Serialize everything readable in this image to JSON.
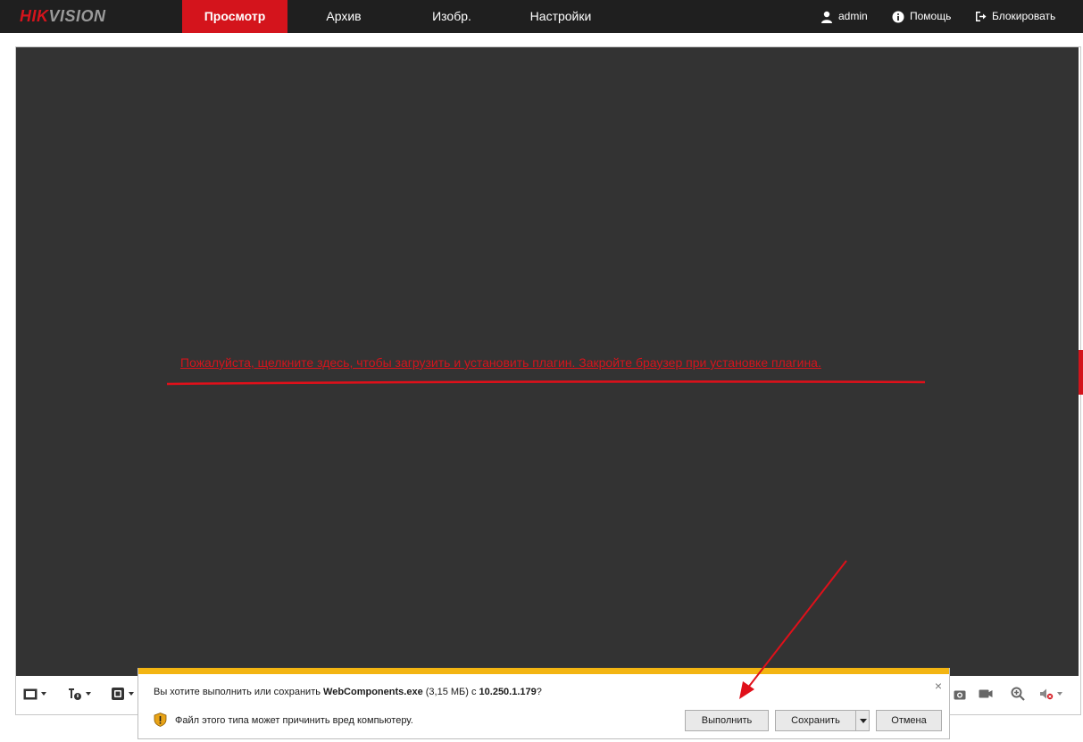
{
  "app": {
    "logo": {
      "part1": "HIK",
      "part2": "VISION"
    },
    "nav": [
      {
        "label": "Просмотр",
        "active": true
      },
      {
        "label": "Архив",
        "active": false
      },
      {
        "label": "Изобр.",
        "active": false
      },
      {
        "label": "Настройки",
        "active": false
      }
    ],
    "user": {
      "username": "admin",
      "help_label": "Помощь",
      "lock_label": "Блокировать"
    }
  },
  "viewer": {
    "plugin_message": "Пожалуйста, щелкните здесь, чтобы загрузить и установить плагин. Закройте браузер при установке плагина."
  },
  "toolbar": {
    "left_icons": [
      "layout-icon",
      "stream-type-icon",
      "plugin-icon"
    ],
    "right_icons": [
      "capture-icon",
      "record-icon",
      "zoom-icon",
      "audio-icon"
    ]
  },
  "download_bar": {
    "question_prefix": "Вы хотите выполнить или сохранить ",
    "file_name": "WebComponents.exe",
    "file_size": " (3,15 МБ) с ",
    "host": "10.250.1.179",
    "question_suffix": "?",
    "warning": "Файл этого типа может причинить вред компьютеру.",
    "run_label": "Выполнить",
    "save_label": "Сохранить",
    "cancel_label": "Отмена",
    "close_symbol": "×"
  },
  "colors": {
    "brand_red": "#d4141c",
    "topbar_bg": "#1f1f1f",
    "video_bg": "#333333",
    "download_accent": "#f3b512"
  }
}
